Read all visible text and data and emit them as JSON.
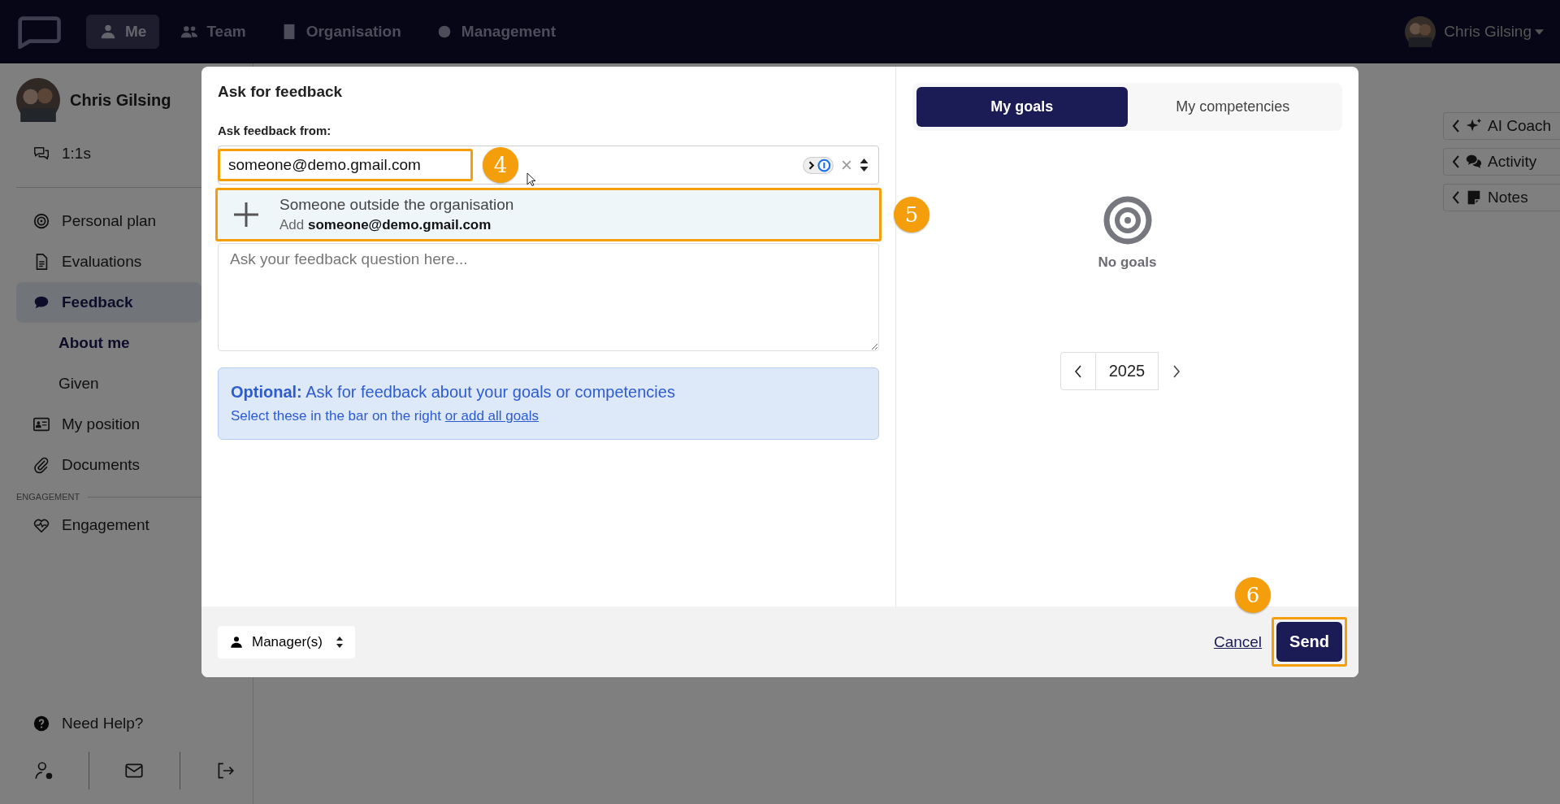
{
  "nav": {
    "items": [
      {
        "label": "Me",
        "selected": true
      },
      {
        "label": "Team",
        "selected": false
      },
      {
        "label": "Organisation",
        "selected": false
      },
      {
        "label": "Management",
        "selected": false
      }
    ],
    "user": "Chris Gilsing"
  },
  "sidebar": {
    "user": "Chris Gilsing",
    "top_item": {
      "label": "1:1s"
    },
    "items": [
      {
        "label": "Personal plan",
        "selected": false
      },
      {
        "label": "Evaluations",
        "selected": false
      },
      {
        "label": "Feedback",
        "selected": true,
        "children": [
          {
            "label": "About me",
            "selected": true
          },
          {
            "label": "Given",
            "selected": false
          }
        ]
      },
      {
        "label": "My position",
        "selected": false
      },
      {
        "label": "Documents",
        "selected": false
      }
    ],
    "section": "ENGAGEMENT",
    "section_items": [
      {
        "label": "Engagement",
        "selected": false
      }
    ],
    "help": "Need Help?"
  },
  "side_panels": [
    {
      "label": "AI Coach"
    },
    {
      "label": "Activity"
    },
    {
      "label": "Notes"
    }
  ],
  "modal": {
    "title": "Ask for feedback",
    "from_label": "Ask feedback from:",
    "recipient_value": "someone@demo.gmail.com",
    "option": {
      "title": "Someone outside the organisation",
      "detail": "Add **someone@demo.gmail.com**"
    },
    "question_placeholder": "Ask your feedback question here...",
    "info": {
      "text": "**Optional:** Ask for feedback about your goals or competencies",
      "hint": "Select these in the bar on the right",
      "link": "or add all goals"
    },
    "tabs": [
      {
        "label": "My goals",
        "selected": true
      },
      {
        "label": "My competencies",
        "selected": false
      }
    ],
    "empty": "No goals",
    "year": "2025",
    "visibility": "Manager(s)",
    "cancel": "Cancel",
    "send": "Send"
  },
  "callouts": [
    "4",
    "5",
    "6"
  ]
}
